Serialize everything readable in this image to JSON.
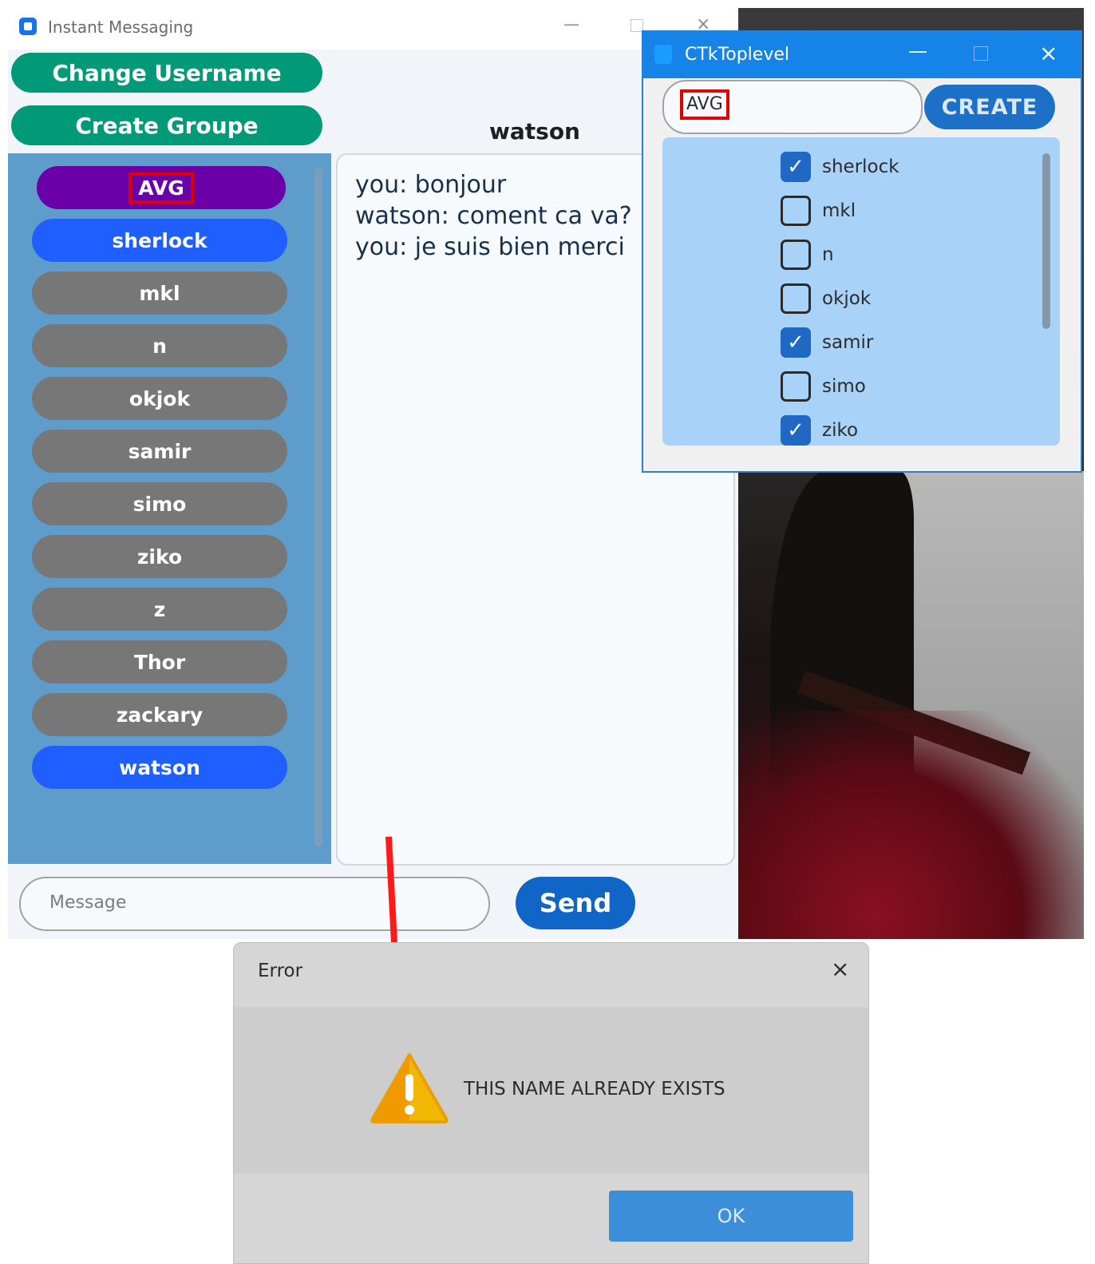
{
  "main_window": {
    "title": "Instant Messaging",
    "controls": {
      "minimize": "—",
      "close": "×"
    },
    "change_username_label": "Change Username",
    "create_group_label": "Create Groupe",
    "contacts": [
      {
        "label": "AVG",
        "kind": "group",
        "highlighted": true
      },
      {
        "label": "sherlock",
        "kind": "active"
      },
      {
        "label": "mkl",
        "kind": "normal"
      },
      {
        "label": "n",
        "kind": "normal"
      },
      {
        "label": "okjok",
        "kind": "normal"
      },
      {
        "label": "samir",
        "kind": "normal"
      },
      {
        "label": "simo",
        "kind": "normal"
      },
      {
        "label": "ziko",
        "kind": "normal"
      },
      {
        "label": "z",
        "kind": "normal"
      },
      {
        "label": "Thor",
        "kind": "normal"
      },
      {
        "label": "zackary",
        "kind": "normal"
      },
      {
        "label": "watson",
        "kind": "active"
      }
    ],
    "chat": {
      "title": "watson",
      "messages": [
        "you: bonjour",
        "watson: coment ca va?",
        "you: je suis bien merci"
      ]
    },
    "message_placeholder": "Message",
    "send_label": "Send"
  },
  "toplevel": {
    "title": "CTkToplevel",
    "controls": {
      "minimize": "—",
      "close": "×"
    },
    "group_name_value": "AVG",
    "create_label": "CREATE",
    "members": [
      {
        "label": "sherlock",
        "checked": true
      },
      {
        "label": "mkl",
        "checked": false
      },
      {
        "label": "n",
        "checked": false
      },
      {
        "label": "okjok",
        "checked": false
      },
      {
        "label": "samir",
        "checked": true
      },
      {
        "label": "simo",
        "checked": false
      },
      {
        "label": "ziko",
        "checked": true
      }
    ]
  },
  "error_dialog": {
    "title": "Error",
    "close": "×",
    "message": "THIS NAME ALREADY EXISTS",
    "ok_label": "OK",
    "icon": "warning-icon"
  },
  "colors": {
    "green_button": "#009a79",
    "group_purple": "#6c00a8",
    "active_blue": "#1f5eff",
    "inactive_gray": "#777777",
    "panel_blue": "#5e9ccb",
    "member_list_bg": "#a8d2f7",
    "annotation_red": "#e00000"
  }
}
